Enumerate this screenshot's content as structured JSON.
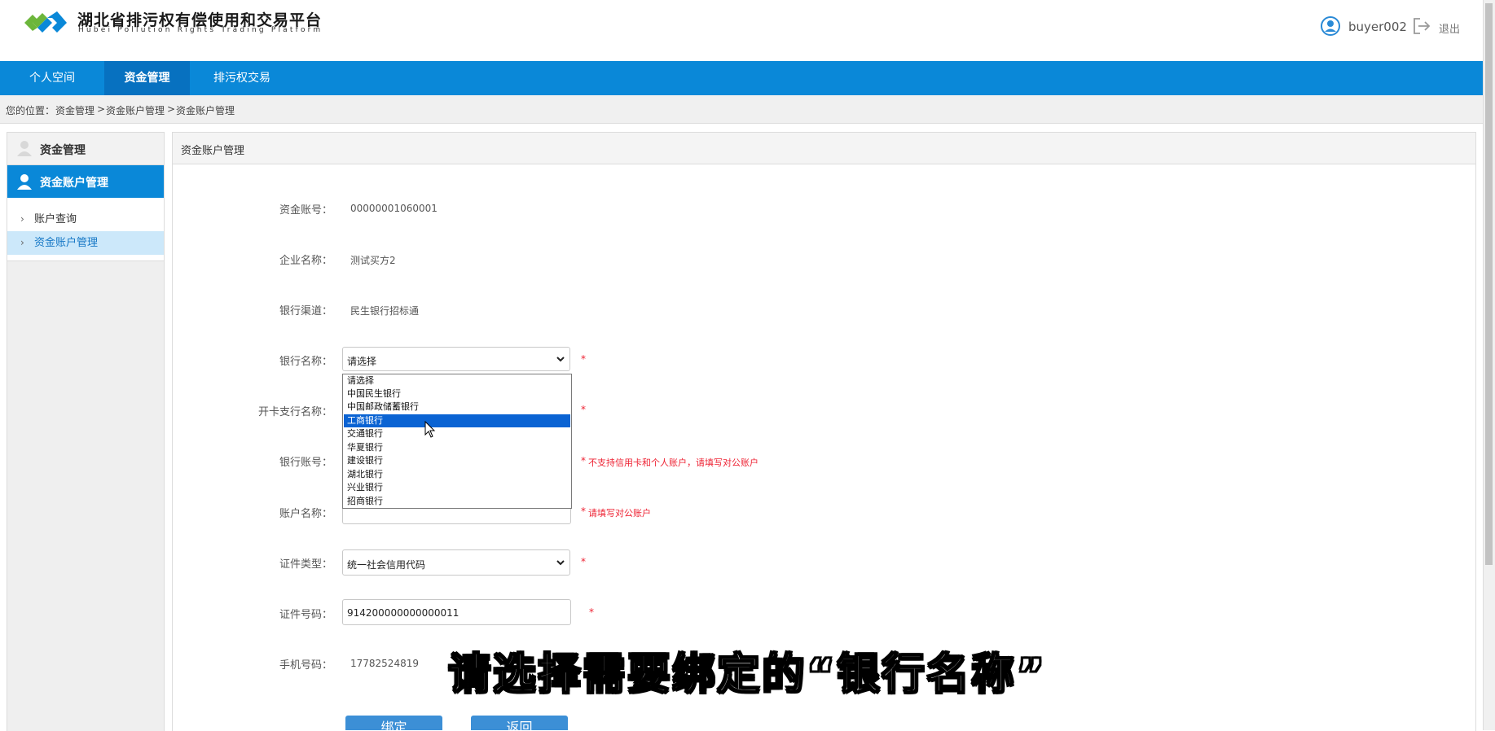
{
  "header": {
    "title": "湖北省排污权有偿使用和交易平台",
    "subtitle": "Hubei Pollution Rights Trading Platform",
    "username": "buyer002",
    "logout_label": "退出",
    "brand_colors": [
      "#0a88d8",
      "#6cb63b"
    ]
  },
  "nav": {
    "items": [
      {
        "label": "个人空间"
      },
      {
        "label": "资金管理"
      },
      {
        "label": "排污权交易"
      }
    ],
    "active_index": 1
  },
  "breadcrumb": {
    "prefix": "您的位置：",
    "items": [
      "资金管理",
      "资金账户管理",
      "资金账户管理"
    ],
    "separator": ">"
  },
  "sidebar": {
    "section_title": "资金管理",
    "group_title": "资金账户管理",
    "items": [
      {
        "label": "账户查询"
      },
      {
        "label": "资金账户管理"
      }
    ],
    "active_index": 1
  },
  "panel": {
    "title": "资金账户管理"
  },
  "form": {
    "account_no": {
      "label": "资金账号：",
      "value": "00000001060001"
    },
    "company_name": {
      "label": "企业名称：",
      "value": "测试买方2"
    },
    "bank_channel": {
      "label": "银行渠道：",
      "value": "民生银行招标通"
    },
    "bank_name": {
      "label": "银行名称：",
      "value": "请选择",
      "required_mark": "*"
    },
    "branch_name": {
      "label": "开卡支行名称：",
      "required_mark": "*"
    },
    "bank_account": {
      "label": "银行账号：",
      "required_mark": "*",
      "hint": "不支持信用卡和个人账户，请填写对公账户"
    },
    "account_name": {
      "label": "账户名称：",
      "required_mark": "*",
      "hint": "请填写对公账户"
    },
    "cert_type": {
      "label": "证件类型：",
      "value": "统一社会信用代码",
      "required_mark": "*"
    },
    "cert_no": {
      "label": "证件号码：",
      "value": "914200000000000011",
      "required_mark": "*"
    },
    "phone": {
      "label": "手机号码：",
      "value": "17782524819"
    }
  },
  "bank_dropdown": {
    "options": [
      "请选择",
      "中国民生银行",
      "中国邮政储蓄银行",
      "工商银行",
      "交通银行",
      "华夏银行",
      "建设银行",
      "湖北银行",
      "兴业银行",
      "招商银行"
    ],
    "highlighted_index": 3
  },
  "buttons": {
    "bind": "绑定",
    "back": "返回"
  },
  "subtitle_caption": "请选择需要绑定的“银行名称”"
}
